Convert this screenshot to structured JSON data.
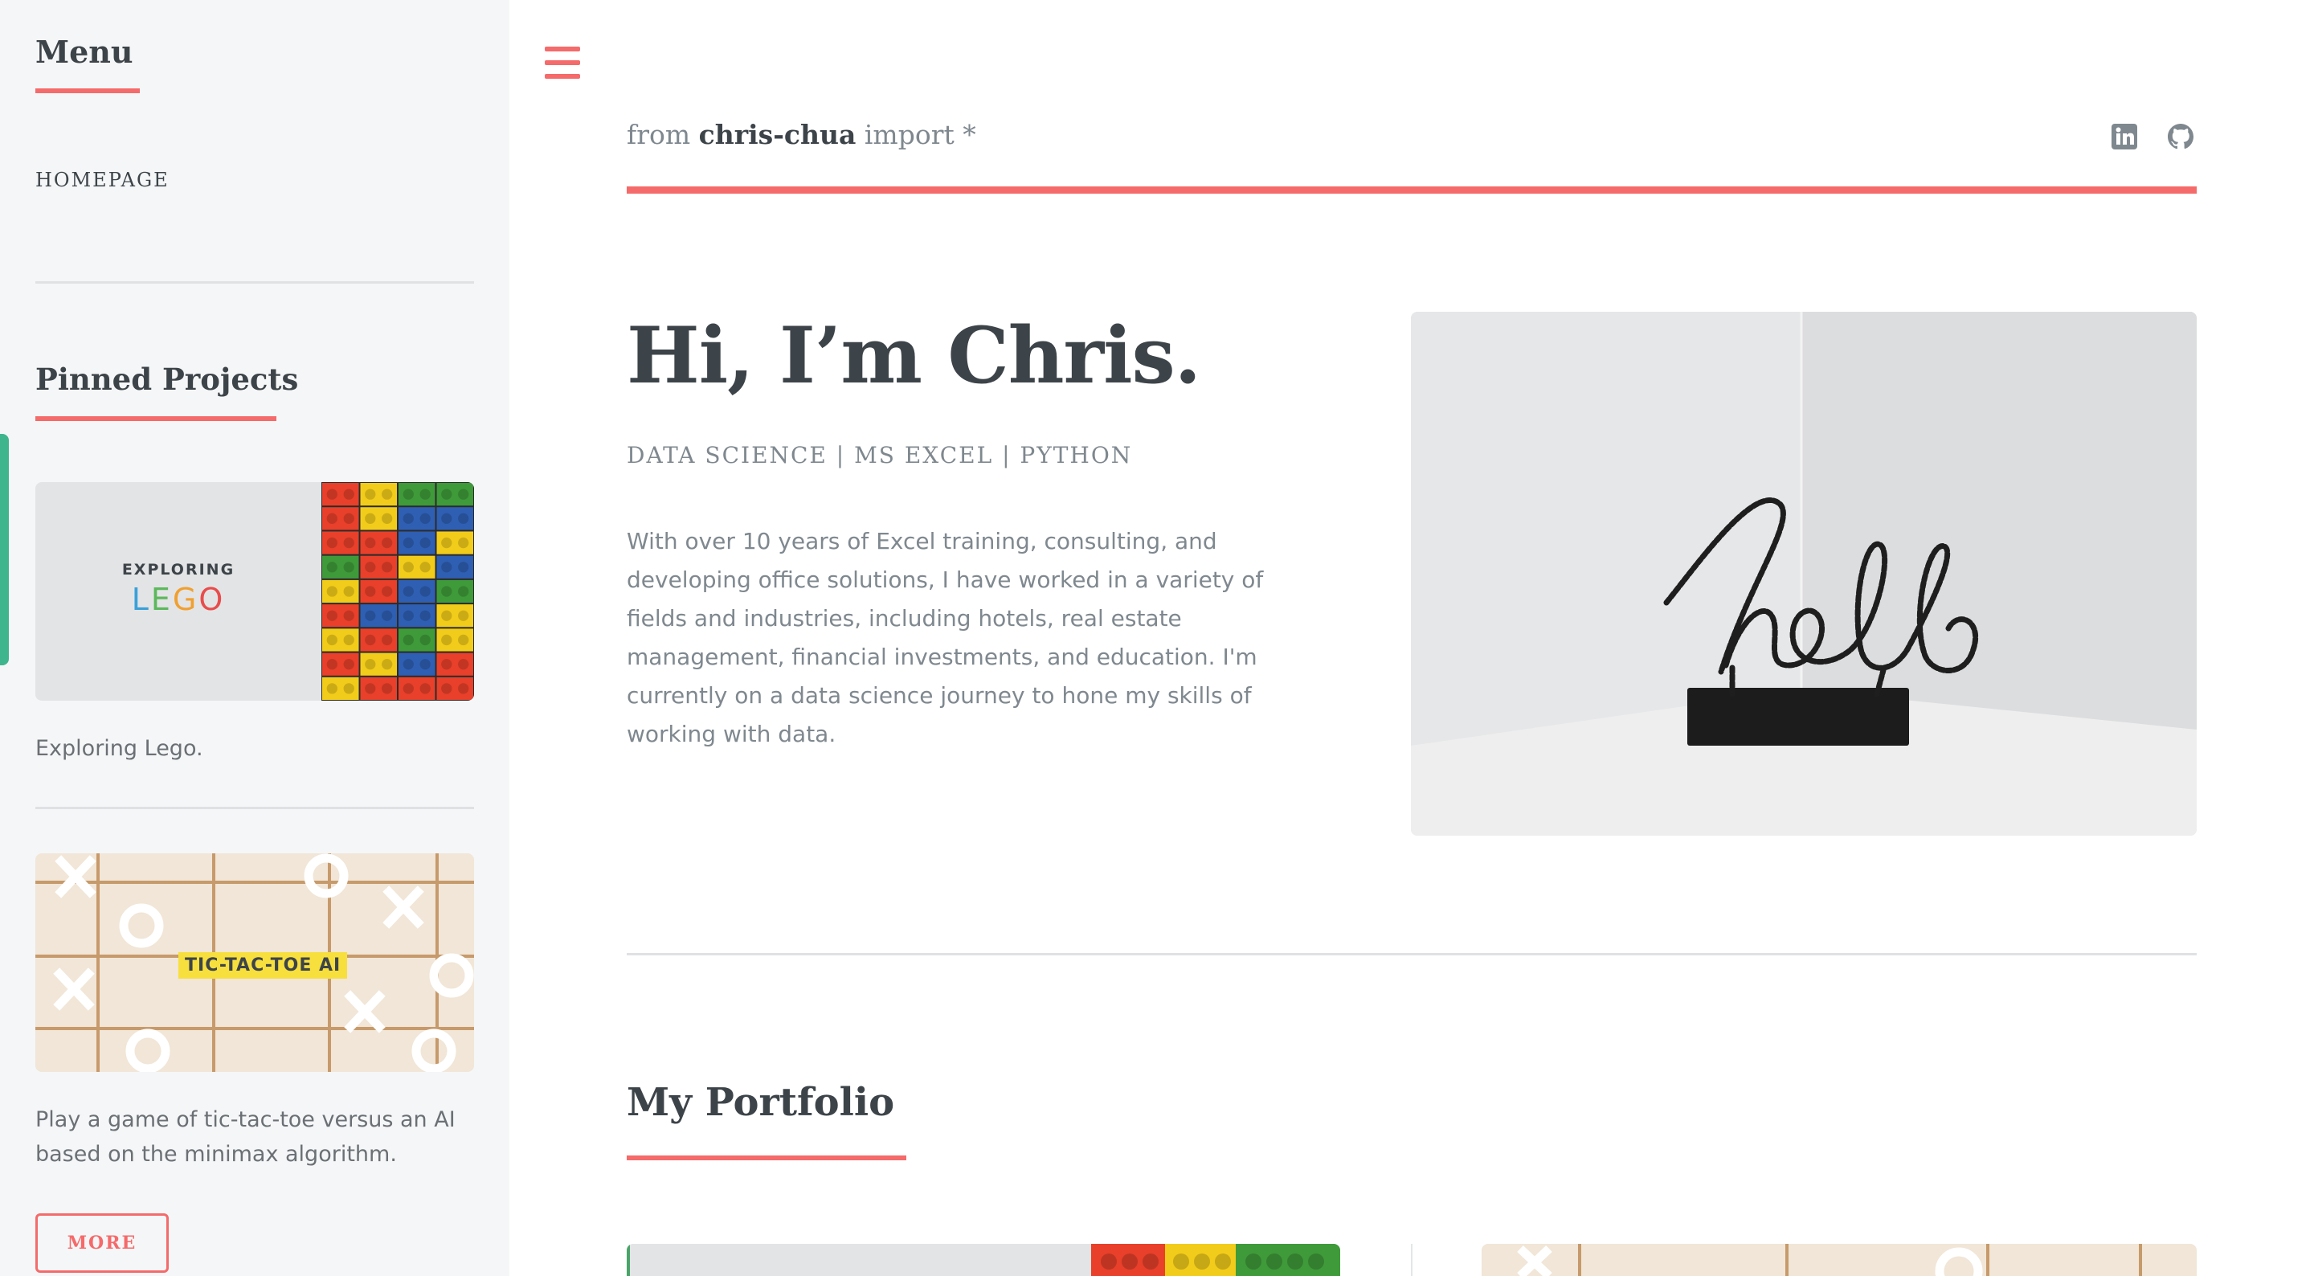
{
  "sidebar": {
    "menu_title": "Menu",
    "menu_items": [
      {
        "label": "HOMEPAGE"
      }
    ],
    "pinned_title": "Pinned Projects",
    "projects": [
      {
        "image_small": "EXPLORING",
        "image_big": "LEGO",
        "caption": "Exploring Lego."
      },
      {
        "image_label": "TIC-TAC-TOE AI",
        "caption": "Play a game of tic-tac-toe versus an AI based on the minimax algorithm."
      }
    ],
    "more_label": "MORE"
  },
  "header": {
    "brand_prefix": "from ",
    "brand_name": "chris-chua",
    "brand_suffix": " import *",
    "icons": [
      "linkedin-icon",
      "github-icon"
    ]
  },
  "hero": {
    "title": "Hi, I’m Chris.",
    "subtitle": "DATA SCIENCE | MS EXCEL | PYTHON",
    "body": "With over 10 years of Excel training, consulting, and developing office solutions, I have worked in a variety of fields and industries, including hotels, real estate management, financial investments, and education. I'm currently on a data science journey to hone my skills of working with data.",
    "image_text": "hello"
  },
  "portfolio": {
    "title": "My Portfolio"
  },
  "colors": {
    "accent": "#f56a6a",
    "text": "#3d4449",
    "muted": "#7f888f",
    "sidebar_bg": "#f5f6f7"
  }
}
